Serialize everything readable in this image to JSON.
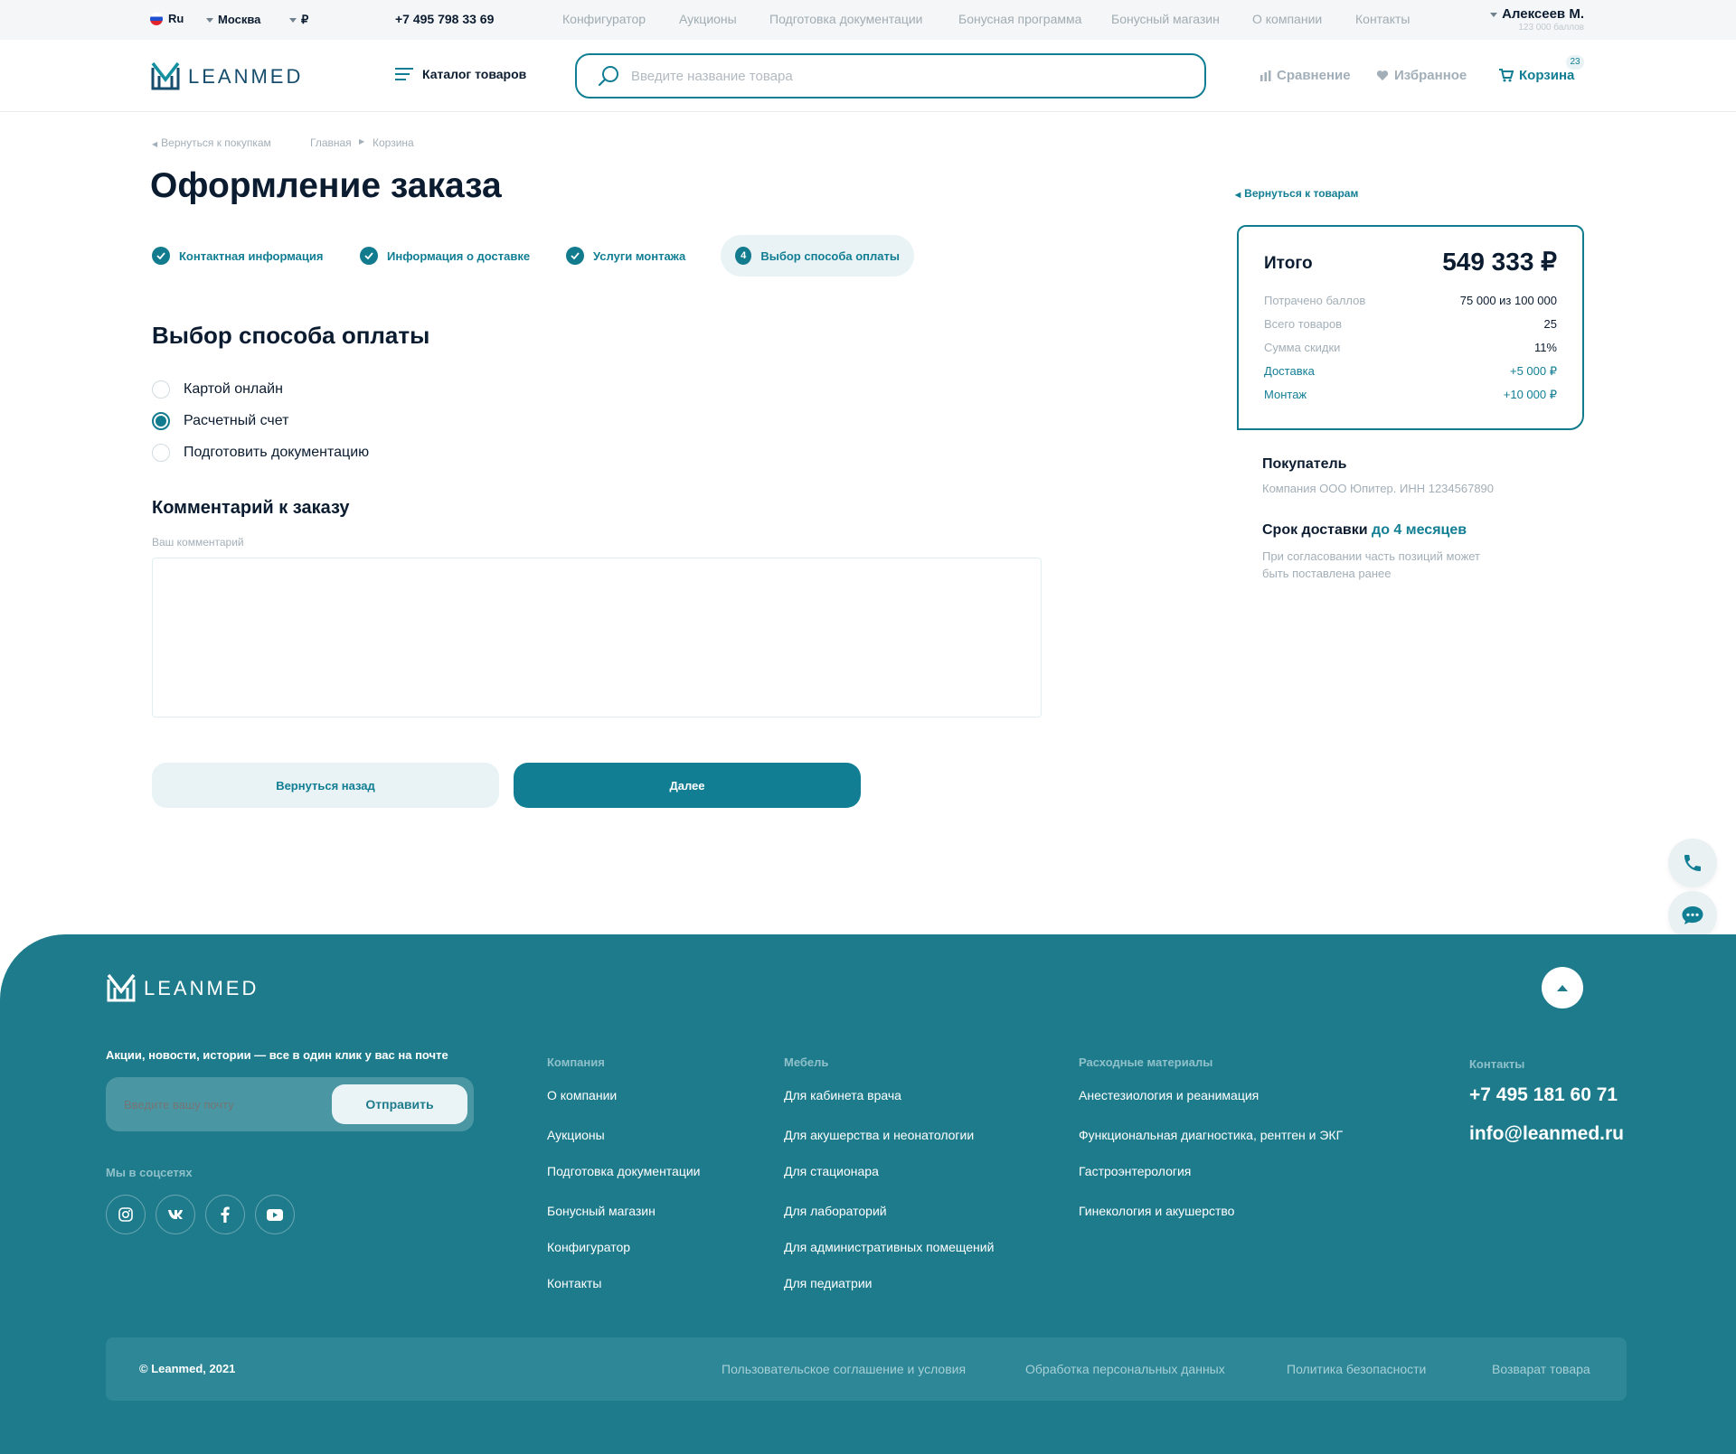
{
  "topbar": {
    "language": "Ru",
    "city": "Москва",
    "currency": "₽",
    "phone": "+7 495 798 33 69",
    "nav": [
      "Конфигуратор",
      "Аукционы",
      "Подготовка документации",
      "Бонусная программа",
      "Бонусный магазин",
      "О компании",
      "Контакты"
    ],
    "user_name": "Алексеев М.",
    "user_points": "123 000 баллов"
  },
  "header": {
    "logo_text": "LEANMED",
    "catalog_label": "Каталог товаров",
    "search_placeholder": "Введите название товара",
    "compare_label": "Сравнение",
    "favorites_label": "Избранное",
    "cart_label": "Корзина",
    "cart_count": "23"
  },
  "breadcrumb": {
    "back": "Вернуться к покупкам",
    "home": "Главная",
    "current": "Корзина"
  },
  "page_title": "Оформление заказа",
  "steps": [
    {
      "label": "Контактная информация",
      "done": true
    },
    {
      "label": "Информация о доставке",
      "done": true
    },
    {
      "label": "Услуги монтажа",
      "done": true
    },
    {
      "label": "Выбор способа оплаты",
      "number": "4",
      "active": true
    }
  ],
  "payment": {
    "title": "Выбор способа оплаты",
    "options": [
      {
        "label": "Картой онлайн",
        "selected": false
      },
      {
        "label": "Расчетный счет",
        "selected": true
      },
      {
        "label": "Подготовить документацию",
        "selected": false
      }
    ]
  },
  "comment": {
    "title": "Комментарий к заказу",
    "label": "Ваш комментарий",
    "value": ""
  },
  "buttons": {
    "back": "Вернуться назад",
    "next": "Далее"
  },
  "summary": {
    "back_link": "Вернуться к товарам",
    "total_label": "Итого",
    "total_value": "549 333 ₽",
    "rows": [
      {
        "label": "Потрачено баллов",
        "value": "75 000 из 100 000"
      },
      {
        "label": "Всего товаров",
        "value": "25"
      },
      {
        "label": "Сумма скидки",
        "value": "11%"
      },
      {
        "label": "Доставка",
        "value": "+5 000 ₽"
      },
      {
        "label": "Монтаж",
        "value": "+10 000 ₽"
      }
    ],
    "buyer_title": "Покупатель",
    "buyer_value": "Компания ООО Юпитер. ИНН 1234567890",
    "delivery_title": "Срок доставки",
    "delivery_highlight": "до 4 месяцев",
    "delivery_note_1": "При согласовании часть позиций может",
    "delivery_note_2": "быть поставлена ранее"
  },
  "footer": {
    "logo_text": "LEANMED",
    "newsletter_title": "Акции, новости, истории — все в один клик у вас на почте",
    "email_placeholder": "Введите вашу почту",
    "submit_label": "Отправить",
    "social_title": "Мы в соцсетях",
    "columns": [
      {
        "title": "Компания",
        "links": [
          "О компании",
          "Аукционы",
          "Подготовка документации",
          "Бонусный магазин",
          "Конфигуратор",
          "Контакты"
        ]
      },
      {
        "title": "Мебель",
        "links": [
          "Для кабинета врача",
          "Для акушерства и неонатологии",
          "Для стационара",
          "Для лабораторий",
          "Для административных помещений",
          "Для педиатрии"
        ]
      },
      {
        "title": "Расходные материалы",
        "links": [
          "Анестезиология и реанимация",
          "Функциональная диагностика, рентген и ЭКГ",
          "Гастроэнтерология",
          "Гинекология и акушерство"
        ]
      }
    ],
    "contacts_title": "Контакты",
    "contact_phone": "+7 495 181 60 71",
    "contact_email": "info@leanmed.ru",
    "copyright": "© Leanmed, 2021",
    "legal_links": [
      "Пользовательское соглашение и условия",
      "Обработка персональных данных",
      "Политика безопасности",
      "Возварат товара"
    ]
  },
  "colors": {
    "accent": "#117e93",
    "footer_bg": "#1e7b8c",
    "text_dark": "#0c1c30",
    "muted": "#a3afb8"
  }
}
